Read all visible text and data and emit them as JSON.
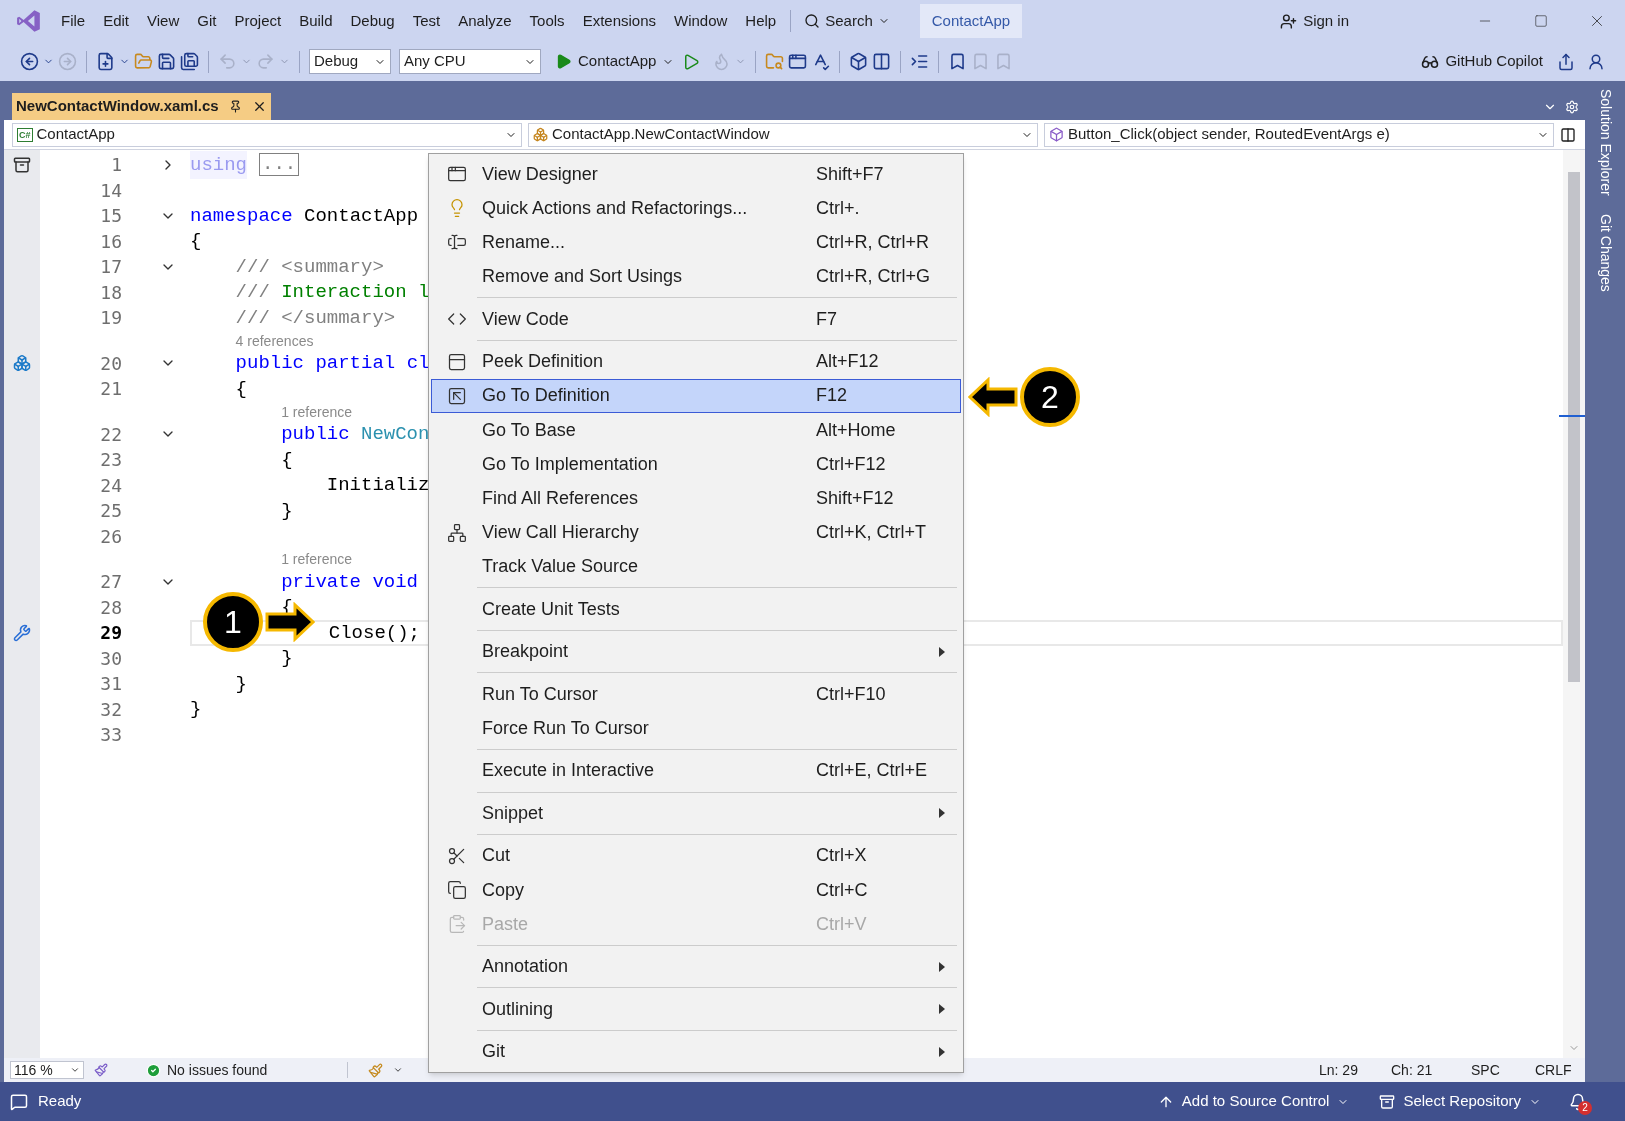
{
  "title_bar": {
    "menus": [
      "File",
      "Edit",
      "View",
      "Git",
      "Project",
      "Build",
      "Debug",
      "Test",
      "Analyze",
      "Tools",
      "Extensions",
      "Window",
      "Help"
    ],
    "search": "Search",
    "solution_name": "ContactApp",
    "sign_in": "Sign in"
  },
  "toolbar": {
    "configuration": "Debug",
    "platform": "Any CPU",
    "startup_project": "ContactApp",
    "copilot": "GitHub Copilot"
  },
  "document_tabs": [
    {
      "label": "NewContactWindow.xaml.cs",
      "selected": true
    }
  ],
  "navigation_bar": {
    "project_badge": "C#",
    "items": [
      "ContactApp",
      "ContactApp.NewContactWindow",
      "Button_Click(object sender, RoutedEventArgs e)"
    ]
  },
  "editor": {
    "lines": [
      {
        "number": "1",
        "outline": {
          "expanded": false
        },
        "current": false,
        "tokens": [
          {
            "text": "using",
            "kind": "faded"
          },
          {
            "text": "...",
            "kind": "collapsed"
          }
        ]
      },
      {
        "number": "14",
        "current": false
      },
      {
        "number": "15",
        "outline": {
          "expanded": true
        },
        "current": false,
        "tokens": [
          {
            "text": "namespace",
            "kind": "keyword"
          },
          {
            "text": " ContactApp",
            "kind": "plain"
          }
        ]
      },
      {
        "number": "16",
        "current": false,
        "tokens": [
          {
            "text": "{",
            "kind": "plain"
          }
        ]
      },
      {
        "number": "17",
        "outline": {
          "expanded": true
        },
        "current": false,
        "tokens": [
          {
            "text": "    /// <summary>",
            "kind": "doc"
          }
        ]
      },
      {
        "number": "18",
        "current": false,
        "tokens": [
          {
            "text": "    /// ",
            "kind": "doc"
          },
          {
            "text": "Interaction l",
            "kind": "comment"
          }
        ]
      },
      {
        "number": "19",
        "current": false,
        "tokens": [
          {
            "text": "    /// </summary>",
            "kind": "doc"
          }
        ]
      },
      {
        "number": "20",
        "outline": {
          "expanded": true
        },
        "lens": "4 references",
        "current": false,
        "tokens": [
          {
            "text": "    public",
            "kind": "keyword"
          },
          {
            "text": " partial",
            "kind": "keyword"
          },
          {
            "text": " cl",
            "kind": "keyword"
          }
        ]
      },
      {
        "number": "21",
        "current": false,
        "tokens": [
          {
            "text": "    {",
            "kind": "plain"
          }
        ]
      },
      {
        "number": "22",
        "outline": {
          "expanded": true
        },
        "lens": "1 reference",
        "current": false,
        "tokens": [
          {
            "text": "        public",
            "kind": "keyword"
          },
          {
            "text": " NewCon",
            "kind": "type"
          }
        ]
      },
      {
        "number": "23",
        "current": false,
        "tokens": [
          {
            "text": "        {",
            "kind": "plain"
          }
        ]
      },
      {
        "number": "24",
        "current": false,
        "tokens": [
          {
            "text": "            Initializ",
            "kind": "plain"
          }
        ]
      },
      {
        "number": "25",
        "current": false,
        "tokens": [
          {
            "text": "        }",
            "kind": "plain"
          }
        ]
      },
      {
        "number": "26",
        "current": false
      },
      {
        "number": "27",
        "outline": {
          "expanded": true
        },
        "lens": "1 reference",
        "current": false,
        "tokens": [
          {
            "text": "        private",
            "kind": "keyword"
          },
          {
            "text": " void",
            "kind": "keyword"
          }
        ]
      },
      {
        "number": "28",
        "current": false,
        "tokens": [
          {
            "text": "        {",
            "kind": "plain"
          }
        ]
      },
      {
        "number": "29",
        "current": true,
        "tokens": [
          {
            "text": "            Close();",
            "kind": "plain"
          }
        ]
      },
      {
        "number": "30",
        "current": false,
        "tokens": [
          {
            "text": "        }",
            "kind": "plain"
          }
        ]
      },
      {
        "number": "31",
        "current": false,
        "tokens": [
          {
            "text": "    }",
            "kind": "plain"
          }
        ]
      },
      {
        "number": "32",
        "current": false,
        "tokens": [
          {
            "text": "}",
            "kind": "plain"
          }
        ]
      },
      {
        "number": "33",
        "current": false
      }
    ]
  },
  "context_menu": {
    "groups": [
      {
        "items": [
          {
            "label": "View Designer",
            "shortcut": "Shift+F7",
            "selected": false,
            "disabled": false,
            "submenu": false
          },
          {
            "label": "Quick Actions and Refactorings...",
            "shortcut": "Ctrl+.",
            "selected": false,
            "disabled": false,
            "submenu": false
          },
          {
            "label": "Rename...",
            "shortcut": "Ctrl+R, Ctrl+R",
            "selected": false,
            "disabled": false,
            "submenu": false
          },
          {
            "label": "Remove and Sort Usings",
            "shortcut": "Ctrl+R, Ctrl+G",
            "selected": false,
            "disabled": false,
            "submenu": false
          }
        ]
      },
      {
        "items": [
          {
            "label": "View Code",
            "shortcut": "F7",
            "selected": false,
            "disabled": false,
            "submenu": false
          }
        ]
      },
      {
        "items": [
          {
            "label": "Peek Definition",
            "shortcut": "Alt+F12",
            "selected": false,
            "disabled": false,
            "submenu": false
          },
          {
            "label": "Go To Definition",
            "shortcut": "F12",
            "selected": true,
            "disabled": false,
            "submenu": false
          },
          {
            "label": "Go To Base",
            "shortcut": "Alt+Home",
            "selected": false,
            "disabled": false,
            "submenu": false
          },
          {
            "label": "Go To Implementation",
            "shortcut": "Ctrl+F12",
            "selected": false,
            "disabled": false,
            "submenu": false
          },
          {
            "label": "Find All References",
            "shortcut": "Shift+F12",
            "selected": false,
            "disabled": false,
            "submenu": false
          },
          {
            "label": "View Call Hierarchy",
            "shortcut": "Ctrl+K, Ctrl+T",
            "selected": false,
            "disabled": false,
            "submenu": false
          },
          {
            "label": "Track Value Source",
            "selected": false,
            "disabled": false,
            "submenu": false
          }
        ]
      },
      {
        "items": [
          {
            "label": "Create Unit Tests",
            "selected": false,
            "disabled": false,
            "submenu": false
          }
        ]
      },
      {
        "items": [
          {
            "label": "Breakpoint",
            "selected": false,
            "disabled": false,
            "submenu": true
          }
        ]
      },
      {
        "items": [
          {
            "label": "Run To Cursor",
            "shortcut": "Ctrl+F10",
            "selected": false,
            "disabled": false,
            "submenu": false
          },
          {
            "label": "Force Run To Cursor",
            "selected": false,
            "disabled": false,
            "submenu": false
          }
        ]
      },
      {
        "items": [
          {
            "label": "Execute in Interactive",
            "shortcut": "Ctrl+E, Ctrl+E",
            "selected": false,
            "disabled": false,
            "submenu": false
          }
        ]
      },
      {
        "items": [
          {
            "label": "Snippet",
            "selected": false,
            "disabled": false,
            "submenu": true
          }
        ]
      },
      {
        "items": [
          {
            "label": "Cut",
            "shortcut": "Ctrl+X",
            "selected": false,
            "disabled": false,
            "submenu": false
          },
          {
            "label": "Copy",
            "shortcut": "Ctrl+C",
            "selected": false,
            "disabled": false,
            "submenu": false
          },
          {
            "label": "Paste",
            "shortcut": "Ctrl+V",
            "selected": false,
            "disabled": true,
            "submenu": false
          }
        ]
      },
      {
        "items": [
          {
            "label": "Annotation",
            "selected": false,
            "disabled": false,
            "submenu": true
          }
        ]
      },
      {
        "items": [
          {
            "label": "Outlining",
            "selected": false,
            "disabled": false,
            "submenu": true
          }
        ]
      },
      {
        "items": [
          {
            "label": "Git",
            "selected": false,
            "disabled": false,
            "submenu": true
          }
        ]
      }
    ]
  },
  "callouts": [
    {
      "label": "1"
    },
    {
      "label": "2"
    }
  ],
  "editor_status": {
    "zoom": "116 %",
    "issues": "No issues found",
    "line": "Ln: 29",
    "column": "Ch: 21",
    "whitespace": "SPC",
    "line_endings": "CRLF"
  },
  "side_panel": [
    "Solution Explorer",
    "Git Changes"
  ],
  "status_bar": {
    "state": "Ready",
    "source_control": "Add to Source Control",
    "repository": "Select Repository",
    "notifications": "2"
  }
}
